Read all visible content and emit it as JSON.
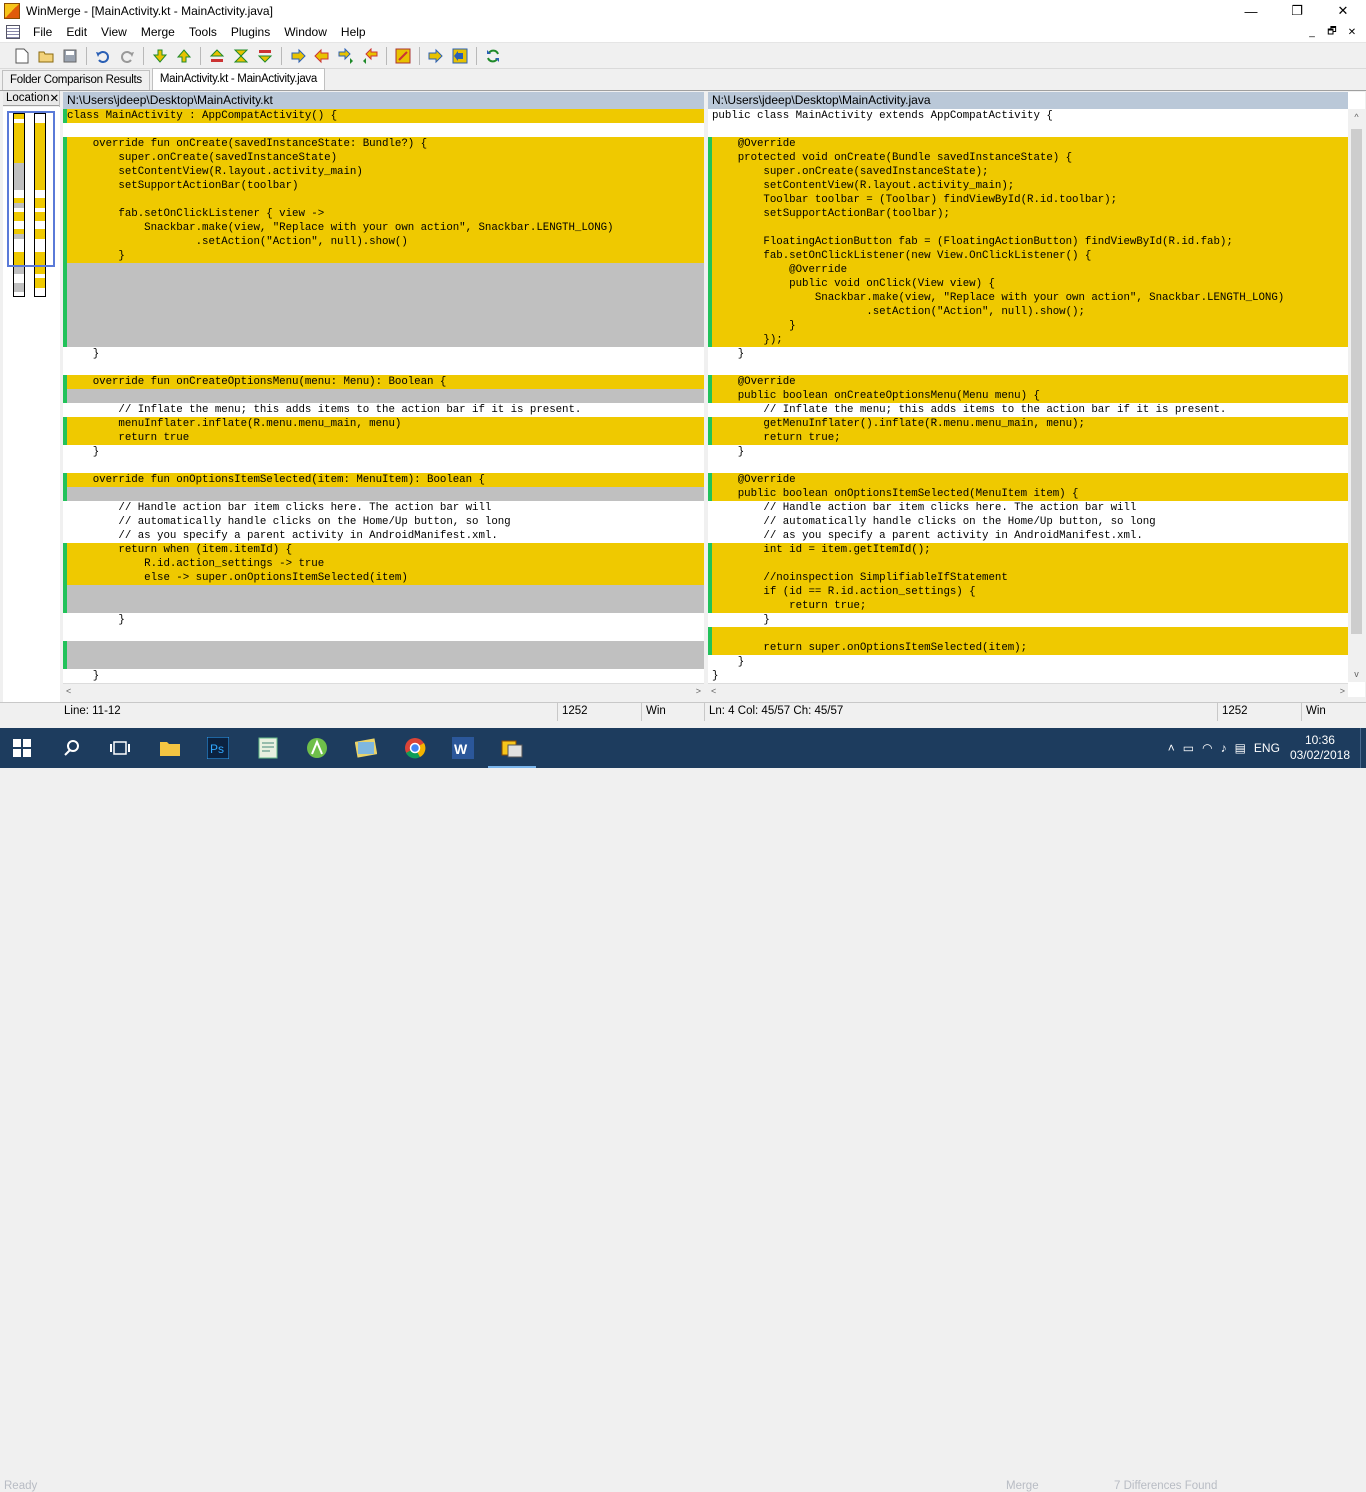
{
  "window": {
    "title": "WinMerge - [MainActivity.kt - MainActivity.java]",
    "minimize": "—",
    "maximize": "❐",
    "close": "✕"
  },
  "menu": {
    "items": [
      "File",
      "Edit",
      "View",
      "Merge",
      "Tools",
      "Plugins",
      "Window",
      "Help"
    ],
    "mdi_min": "_",
    "mdi_restore": "🗗",
    "mdi_close": "✕"
  },
  "toolbar_icons": [
    "new-icon",
    "open-icon",
    "save-icon",
    "undo-icon",
    "redo-icon",
    "next-diff-icon",
    "prev-diff-icon",
    "first-diff-icon",
    "current-diff-icon",
    "last-diff-icon",
    "copy-right-icon",
    "copy-left-icon",
    "copy-right-advance-icon",
    "copy-left-advance-icon",
    "all-right-icon",
    "all-left-icon",
    "delete-icon",
    "options-icon",
    "compare-icon",
    "refresh-icon"
  ],
  "tabs": [
    {
      "label": "Folder Comparison Results",
      "active": false
    },
    {
      "label": "MainActivity.kt - MainActivity.java",
      "active": true
    }
  ],
  "location_pane": {
    "title": "Location",
    "close": "✕"
  },
  "left": {
    "path": "N:\\Users\\jdeep\\Desktop\\MainActivity.kt",
    "lines": [
      {
        "t": "class MainActivity : AppCompatActivity() {",
        "s": "d"
      },
      {
        "t": "",
        "s": "p"
      },
      {
        "t": "    override fun onCreate(savedInstanceState: Bundle?) {",
        "s": "d"
      },
      {
        "t": "        super.onCreate(savedInstanceState)",
        "s": "d"
      },
      {
        "t": "        setContentView(R.layout.activity_main)",
        "s": "d"
      },
      {
        "t": "        setSupportActionBar(toolbar)",
        "s": "d"
      },
      {
        "t": "",
        "s": "d"
      },
      {
        "t": "        fab.setOnClickListener { view ->",
        "s": "d"
      },
      {
        "t": "            Snackbar.make(view, \"Replace with your own action\", Snackbar.LENGTH_LONG)",
        "s": "d"
      },
      {
        "t": "                    .setAction(\"Action\", null).show()",
        "s": "d"
      },
      {
        "t": "        }",
        "s": "d"
      },
      {
        "t": "",
        "s": "g"
      },
      {
        "t": "",
        "s": "g"
      },
      {
        "t": "",
        "s": "g"
      },
      {
        "t": "",
        "s": "g"
      },
      {
        "t": "",
        "s": "g"
      },
      {
        "t": "",
        "s": "g"
      },
      {
        "t": "    }",
        "s": "p"
      },
      {
        "t": "",
        "s": "p"
      },
      {
        "t": "    override fun onCreateOptionsMenu(menu: Menu): Boolean {",
        "s": "d"
      },
      {
        "t": "",
        "s": "g"
      },
      {
        "t": "        // Inflate the menu; this adds items to the action bar if it is present.",
        "s": "p"
      },
      {
        "t": "        menuInflater.inflate(R.menu.menu_main, menu)",
        "s": "d"
      },
      {
        "t": "        return true",
        "s": "d"
      },
      {
        "t": "    }",
        "s": "p"
      },
      {
        "t": "",
        "s": "p"
      },
      {
        "t": "    override fun onOptionsItemSelected(item: MenuItem): Boolean {",
        "s": "d"
      },
      {
        "t": "",
        "s": "g"
      },
      {
        "t": "        // Handle action bar item clicks here. The action bar will",
        "s": "p"
      },
      {
        "t": "        // automatically handle clicks on the Home/Up button, so long",
        "s": "p"
      },
      {
        "t": "        // as you specify a parent activity in AndroidManifest.xml.",
        "s": "p"
      },
      {
        "t": "        return when (item.itemId) {",
        "s": "d"
      },
      {
        "t": "            R.id.action_settings -> true",
        "s": "d"
      },
      {
        "t": "            else -> super.onOptionsItemSelected(item)",
        "s": "d"
      },
      {
        "t": "",
        "s": "g"
      },
      {
        "t": "",
        "s": "g"
      },
      {
        "t": "        }",
        "s": "p"
      },
      {
        "t": "",
        "s": "p"
      },
      {
        "t": "",
        "s": "g"
      },
      {
        "t": "",
        "s": "g"
      },
      {
        "t": "    }",
        "s": "p"
      }
    ]
  },
  "right": {
    "path": "N:\\Users\\jdeep\\Desktop\\MainActivity.java",
    "lines": [
      {
        "t": "public class MainActivity extends AppCompatActivity {",
        "s": "p"
      },
      {
        "t": "",
        "s": "p"
      },
      {
        "t": "    @Override",
        "s": "d"
      },
      {
        "t": "    protected void onCreate(Bundle savedInstanceState) {",
        "s": "d"
      },
      {
        "t": "        super.onCreate(savedInstanceState);",
        "s": "d"
      },
      {
        "t": "        setContentView(R.layout.activity_main);",
        "s": "d"
      },
      {
        "t": "        Toolbar toolbar = (Toolbar) findViewById(R.id.toolbar);",
        "s": "d"
      },
      {
        "t": "        setSupportActionBar(toolbar);",
        "s": "d"
      },
      {
        "t": "",
        "s": "d"
      },
      {
        "t": "        FloatingActionButton fab = (FloatingActionButton) findViewById(R.id.fab);",
        "s": "d"
      },
      {
        "t": "        fab.setOnClickListener(new View.OnClickListener() {",
        "s": "d"
      },
      {
        "t": "            @Override",
        "s": "d"
      },
      {
        "t": "            public void onClick(View view) {",
        "s": "d"
      },
      {
        "t": "                Snackbar.make(view, \"Replace with your own action\", Snackbar.LENGTH_LONG)",
        "s": "d"
      },
      {
        "t": "                        .setAction(\"Action\", null).show();",
        "s": "d"
      },
      {
        "t": "            }",
        "s": "d"
      },
      {
        "t": "        });",
        "s": "d"
      },
      {
        "t": "    }",
        "s": "p"
      },
      {
        "t": "",
        "s": "p"
      },
      {
        "t": "    @Override",
        "s": "d"
      },
      {
        "t": "    public boolean onCreateOptionsMenu(Menu menu) {",
        "s": "d"
      },
      {
        "t": "        // Inflate the menu; this adds items to the action bar if it is present.",
        "s": "p"
      },
      {
        "t": "        getMenuInflater().inflate(R.menu.menu_main, menu);",
        "s": "d"
      },
      {
        "t": "        return true;",
        "s": "d"
      },
      {
        "t": "    }",
        "s": "p"
      },
      {
        "t": "",
        "s": "p"
      },
      {
        "t": "    @Override",
        "s": "d"
      },
      {
        "t": "    public boolean onOptionsItemSelected(MenuItem item) {",
        "s": "d"
      },
      {
        "t": "        // Handle action bar item clicks here. The action bar will",
        "s": "p"
      },
      {
        "t": "        // automatically handle clicks on the Home/Up button, so long",
        "s": "p"
      },
      {
        "t": "        // as you specify a parent activity in AndroidManifest.xml.",
        "s": "p"
      },
      {
        "t": "        int id = item.getItemId();",
        "s": "d"
      },
      {
        "t": "",
        "s": "d"
      },
      {
        "t": "        //noinspection SimplifiableIfStatement",
        "s": "d"
      },
      {
        "t": "        if (id == R.id.action_settings) {",
        "s": "d"
      },
      {
        "t": "            return true;",
        "s": "d"
      },
      {
        "t": "        }",
        "s": "p"
      },
      {
        "t": "",
        "s": "d"
      },
      {
        "t": "        return super.onOptionsItemSelected(item);",
        "s": "d"
      },
      {
        "t": "    }",
        "s": "p"
      },
      {
        "t": "}",
        "s": "p"
      }
    ]
  },
  "scroll": {
    "left": "<",
    "right": ">",
    "up": "^",
    "down": "v"
  },
  "status": {
    "left_line": "Line: 11-12",
    "left_codepage": "1252",
    "left_eol": "Win",
    "right_pos": "Ln: 4  Col: 45/57  Ch: 45/57",
    "right_codepage": "1252",
    "right_eol": "Win"
  },
  "ghost_status": {
    "ready": "Ready",
    "merge": "Merge",
    "diffs": "7 Differences Found"
  },
  "taskbar": {
    "icons": [
      "windows-start-icon",
      "search-icon",
      "task-view-icon",
      "file-explorer-icon",
      "photoshop-icon",
      "notepad-icon",
      "android-studio-icon",
      "image-viewer-icon",
      "chrome-icon",
      "word-icon",
      "winmerge-icon"
    ],
    "tray_lang": "ENG",
    "time": "10:36",
    "date": "03/02/2018"
  }
}
